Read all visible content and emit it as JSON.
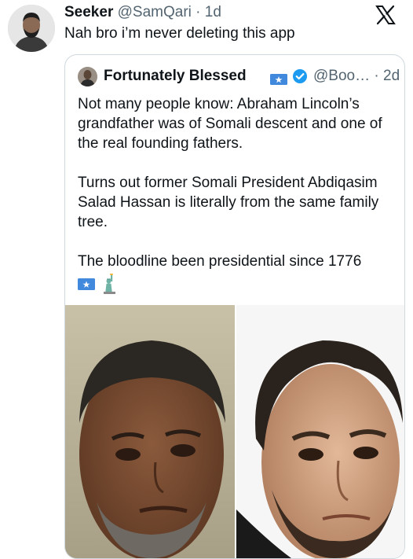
{
  "tweet": {
    "name": "Seeker",
    "handle": "@SamQari",
    "dot": "·",
    "time": "1d",
    "text": "Nah bro i’m never deleting this app"
  },
  "quote": {
    "name": "Fortunately Blessed",
    "handle": "@Boo…",
    "dot": "·",
    "time": "2d",
    "paragraphs": [
      "Not many people know: Abraham Lincoln’s grandfather was of Somali descent and one of the real founding fathers.",
      "Turns out former Somali President Abdiqasim Salad Hassan is literally from the same family tree.",
      "The bloodline been presidential since 1776"
    ]
  },
  "icons": {
    "x_logo": "x-logo-icon",
    "verified": "verified-badge-icon",
    "flag": "somalia-flag-icon",
    "liberty": "statue-of-liberty-icon"
  },
  "colors": {
    "text": "#0f1419",
    "muted": "#536471",
    "verified": "#1d9bf0",
    "border": "#cfd9de",
    "somalia_blue": "#4189dd"
  }
}
